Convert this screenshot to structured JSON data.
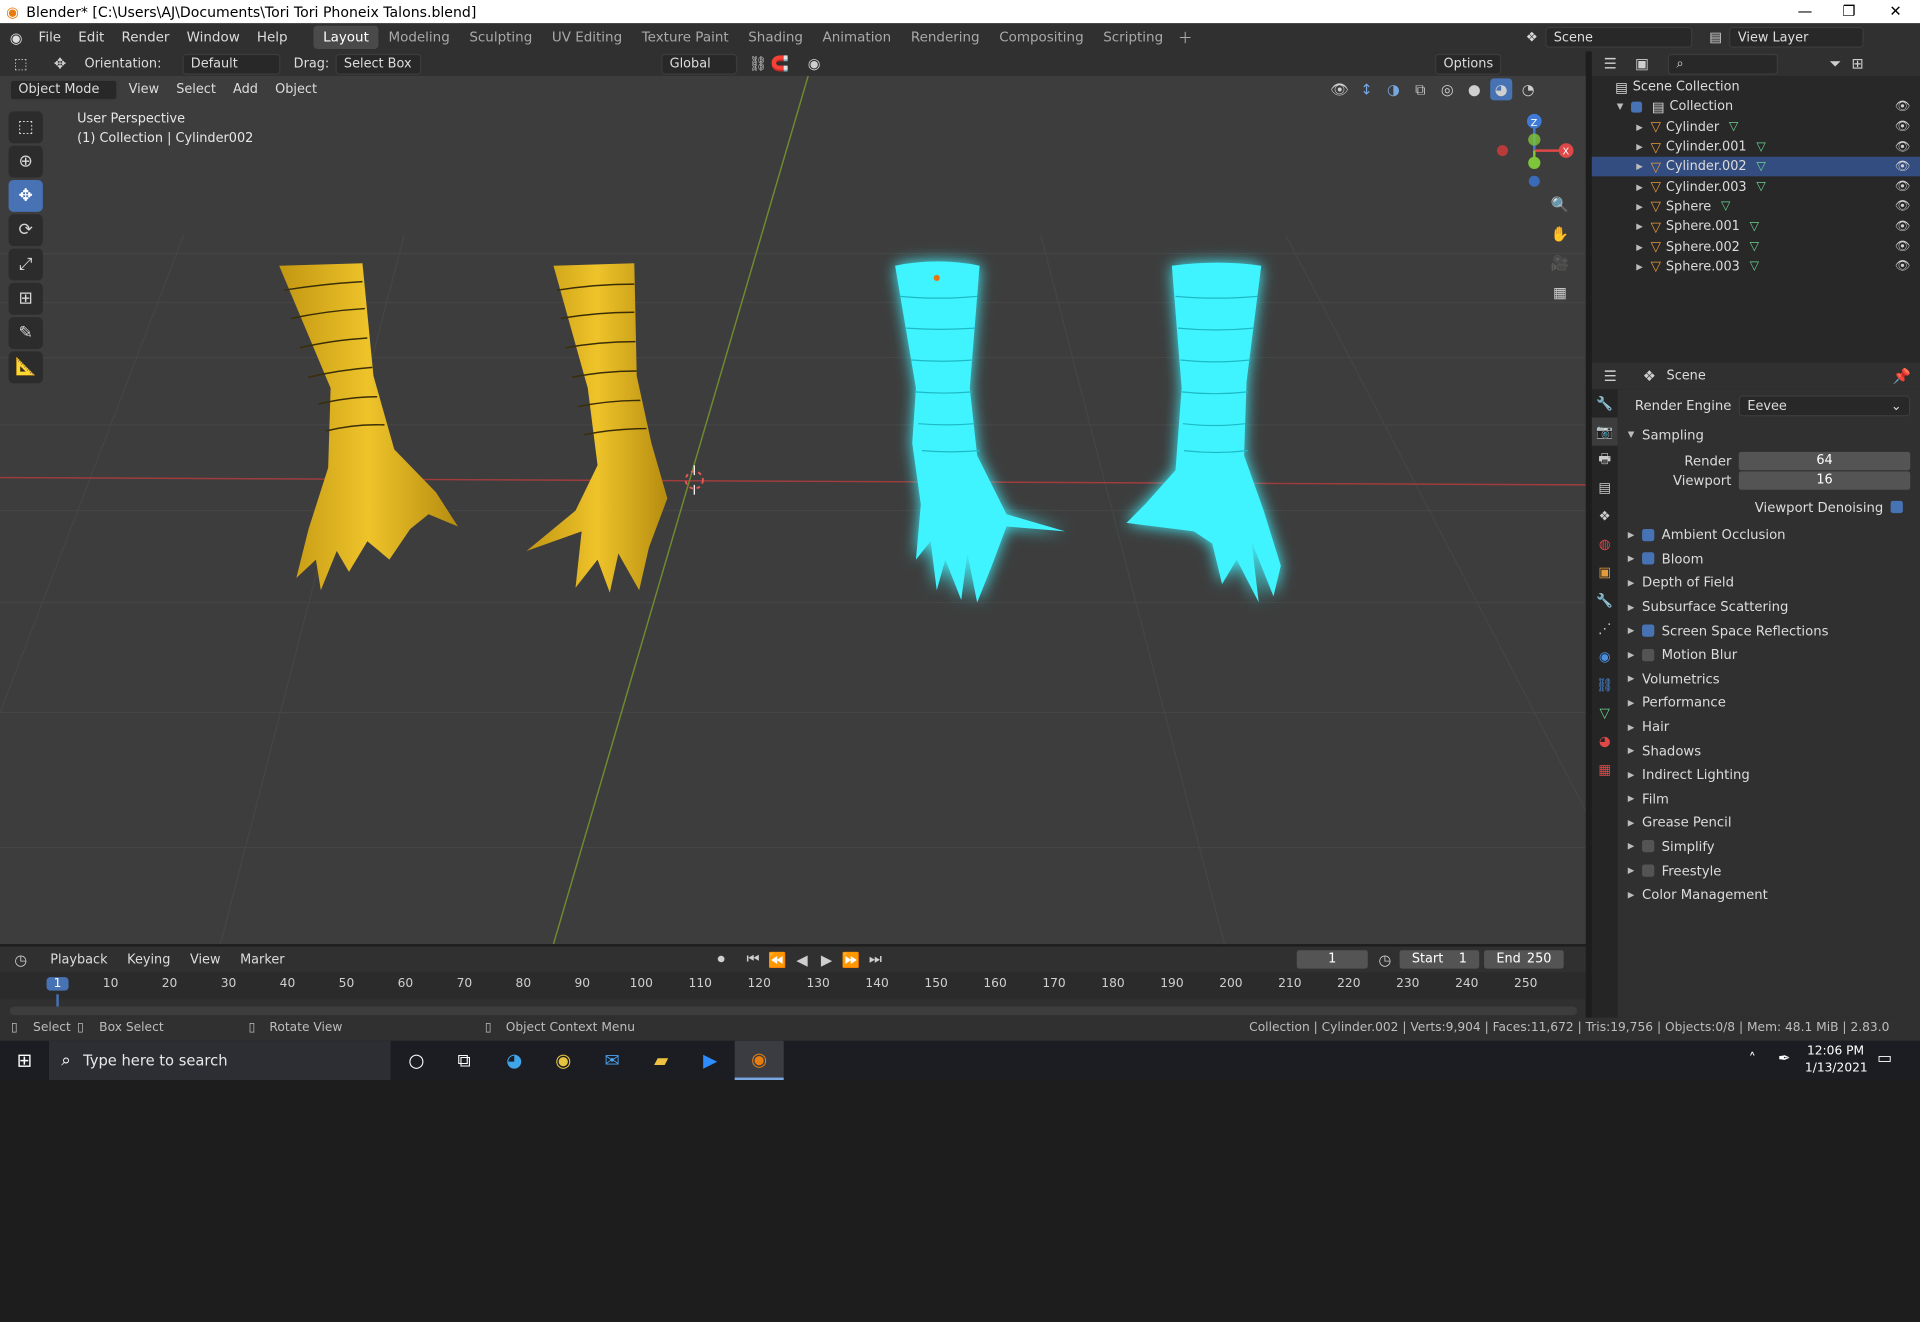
{
  "window": {
    "title": "Blender* [C:\\Users\\AJ\\Documents\\Tori Tori Phoneix Talons.blend]"
  },
  "menu": [
    "File",
    "Edit",
    "Render",
    "Window",
    "Help"
  ],
  "workspaces": [
    "Layout",
    "Modeling",
    "Sculpting",
    "UV Editing",
    "Texture Paint",
    "Shading",
    "Animation",
    "Rendering",
    "Compositing",
    "Scripting"
  ],
  "active_workspace": "Layout",
  "scene_name": "Scene",
  "view_layer": "View Layer",
  "tool_header": {
    "orientation_label": "Orientation:",
    "orientation_value": "Default",
    "drag_label": "Drag:",
    "drag_value": "Select Box",
    "transform": "Global",
    "options": "Options"
  },
  "viewport_header": {
    "mode": "Object Mode",
    "menus": [
      "View",
      "Select",
      "Add",
      "Object"
    ]
  },
  "viewport": {
    "perspective": "User Perspective",
    "collection": "(1) Collection | Cylinder002"
  },
  "gizmo": {
    "z": "Z",
    "x": "X"
  },
  "outliner": {
    "root": "Scene Collection",
    "collection": "Collection",
    "items": [
      "Cylinder",
      "Cylinder.001",
      "Cylinder.002",
      "Cylinder.003",
      "Sphere",
      "Sphere.001",
      "Sphere.002",
      "Sphere.003"
    ]
  },
  "properties": {
    "header": "Scene",
    "render_engine_label": "Render Engine",
    "render_engine_value": "Eevee",
    "sampling": "Sampling",
    "render_label": "Render",
    "render_value": "64",
    "viewport_label": "Viewport",
    "viewport_value": "16",
    "denoise_label": "Viewport Denoising",
    "panels": [
      {
        "label": "Ambient Occlusion",
        "checkbox": true,
        "checked": true
      },
      {
        "label": "Bloom",
        "checkbox": true,
        "checked": true
      },
      {
        "label": "Depth of Field",
        "checkbox": false
      },
      {
        "label": "Subsurface Scattering",
        "checkbox": false
      },
      {
        "label": "Screen Space Reflections",
        "checkbox": true,
        "checked": true
      },
      {
        "label": "Motion Blur",
        "checkbox": true,
        "checked": false
      },
      {
        "label": "Volumetrics",
        "checkbox": false
      },
      {
        "label": "Performance",
        "checkbox": false
      },
      {
        "label": "Hair",
        "checkbox": false
      },
      {
        "label": "Shadows",
        "checkbox": false
      },
      {
        "label": "Indirect Lighting",
        "checkbox": false
      },
      {
        "label": "Film",
        "checkbox": false
      },
      {
        "label": "Grease Pencil",
        "checkbox": false
      },
      {
        "label": "Simplify",
        "checkbox": true,
        "checked": false
      },
      {
        "label": "Freestyle",
        "checkbox": true,
        "checked": false
      },
      {
        "label": "Color Management",
        "checkbox": false
      }
    ]
  },
  "timeline": {
    "menus": [
      "Playback",
      "Keying",
      "View",
      "Marker"
    ],
    "current_frame": "1",
    "start_label": "Start",
    "start": "1",
    "end_label": "End",
    "end": "250",
    "ticks": [
      "1",
      "10",
      "20",
      "30",
      "40",
      "50",
      "60",
      "70",
      "80",
      "90",
      "100",
      "110",
      "120",
      "130",
      "140",
      "150",
      "160",
      "170",
      "180",
      "190",
      "200",
      "210",
      "220",
      "230",
      "240",
      "250"
    ]
  },
  "status": {
    "select": "Select",
    "box_select": "Box Select",
    "rotate": "Rotate View",
    "context": "Object Context Menu",
    "info": "Collection | Cylinder.002 | Verts:9,904 | Faces:11,672 | Tris:19,756 | Objects:0/8 | Mem: 48.1 MiB | 2.83.0"
  },
  "taskbar": {
    "search": "Type here to search",
    "time": "12:06 PM",
    "date": "1/13/2021"
  },
  "colors": {
    "gold": "#e0b21c",
    "cyan": "#40f4ff",
    "accent": "#4772b3"
  }
}
